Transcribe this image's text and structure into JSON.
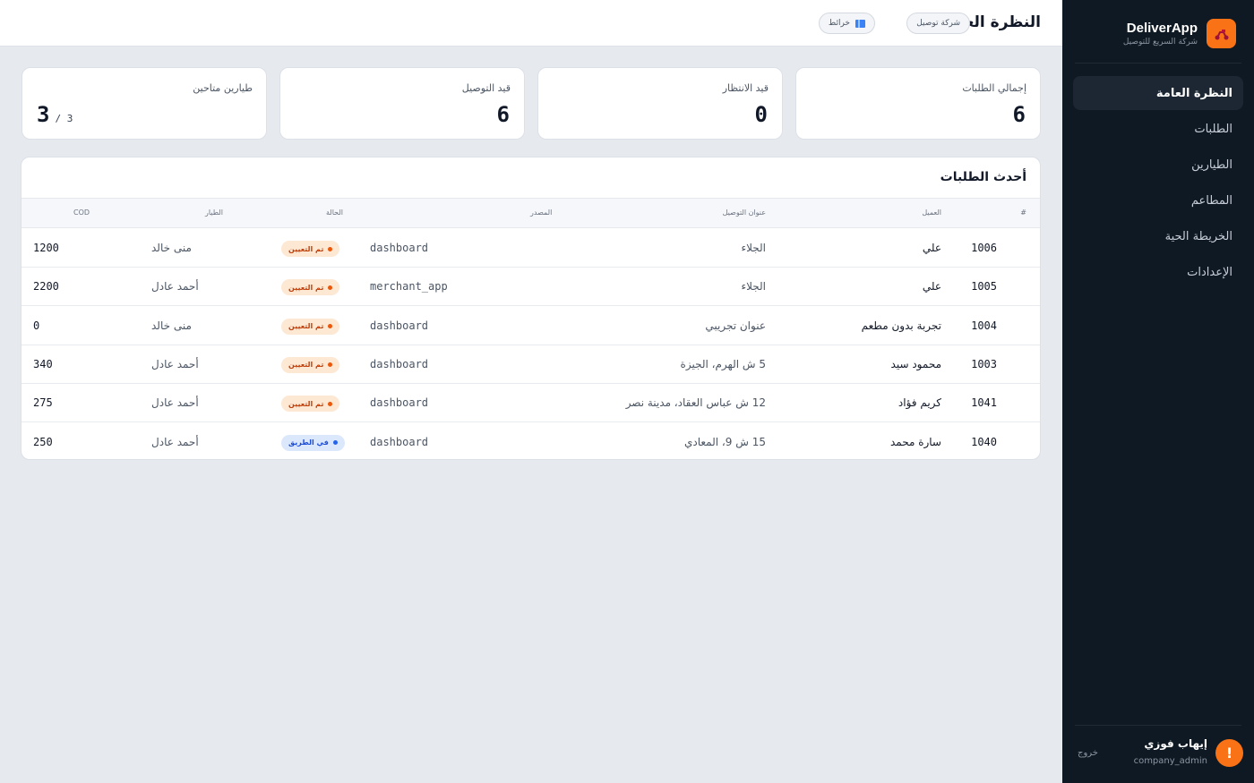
{
  "brand": {
    "name": "DeliverApp",
    "subtitle": "شركة السريع للتوصيل",
    "logo_icon": "scooter-icon"
  },
  "nav": {
    "items": [
      {
        "label": "النظرة العامة",
        "active": true
      },
      {
        "label": "الطلبات",
        "active": false
      },
      {
        "label": "الطيارين",
        "active": false
      },
      {
        "label": "المطاعم",
        "active": false
      },
      {
        "label": "الخريطة الحية",
        "active": false
      },
      {
        "label": "الإعدادات",
        "active": false
      }
    ]
  },
  "user": {
    "avatar": "!",
    "name": "إيهاب فوزي",
    "role": "company_admin",
    "logout_label": "خروج"
  },
  "header": {
    "title": "النظرة العامة",
    "company_badge": "شركة توصيل",
    "maps_label": "خرائط",
    "maps_icon": "map-icon"
  },
  "stats": [
    {
      "label": "إجمالي الطلبات",
      "value": "6"
    },
    {
      "label": "قيد الانتظار",
      "value": "0"
    },
    {
      "label": "قيد التوصيل",
      "value": "6"
    },
    {
      "label": "طيارين متاحين",
      "value": "3",
      "total": "/ 3"
    }
  ],
  "orders": {
    "title": "أحدث الطلبات",
    "columns": {
      "id": "#",
      "client": "العميل",
      "address": "عنوان التوصيل",
      "source": "المصدر",
      "status": "الحالة",
      "courier": "الطيار",
      "cod": "COD"
    },
    "rows": [
      {
        "id": "1006",
        "client": "علي",
        "address": "الجلاء",
        "source": "dashboard",
        "status": "تم التعيين",
        "status_type": "assigned",
        "courier": "منى خالد",
        "cod": "1200"
      },
      {
        "id": "1005",
        "client": "علي",
        "address": "الجلاء",
        "source": "merchant_app",
        "status": "تم التعيين",
        "status_type": "assigned",
        "courier": "أحمد عادل",
        "cod": "2200"
      },
      {
        "id": "1004",
        "client": "تجربة بدون مطعم",
        "address": "عنوان تجريبي",
        "source": "dashboard",
        "status": "تم التعيين",
        "status_type": "assigned",
        "courier": "منى خالد",
        "cod": "0"
      },
      {
        "id": "1003",
        "client": "محمود سيد",
        "address": "5 ش الهرم، الجيزة",
        "source": "dashboard",
        "status": "تم التعيين",
        "status_type": "assigned",
        "courier": "أحمد عادل",
        "cod": "340"
      },
      {
        "id": "1041",
        "client": "كريم فؤاد",
        "address": "12 ش عباس العقاد، مدينة نصر",
        "source": "dashboard",
        "status": "تم التعيين",
        "status_type": "assigned",
        "courier": "أحمد عادل",
        "cod": "275"
      },
      {
        "id": "1040",
        "client": "سارة محمد",
        "address": "15 ش 9، المعادي",
        "source": "dashboard",
        "status": "في الطريق",
        "status_type": "on_the_way",
        "courier": "أحمد عادل",
        "cod": "250"
      }
    ]
  },
  "colors": {
    "accent": "#f97316",
    "sidebar_bg": "#0f1923",
    "assigned_bg": "#fde8d4",
    "assigned_fg": "#c2410c",
    "assigned_dot": "#ea580c",
    "on_the_way_bg": "#dbe8fb",
    "on_the_way_fg": "#1d4ed8",
    "on_the_way_dot": "#2563eb"
  }
}
